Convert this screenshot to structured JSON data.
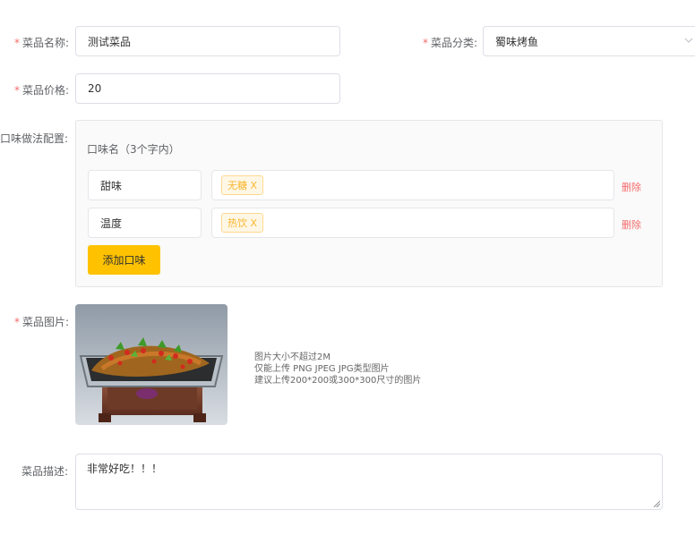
{
  "form": {
    "name": {
      "label": "菜品名称:",
      "value": "测试菜品"
    },
    "category": {
      "label": "菜品分类:",
      "value": "蜀味烤鱼"
    },
    "price": {
      "label": "菜品价格:",
      "value": "20"
    },
    "flavor": {
      "label": "口味做法配置:",
      "header": "口味名（3个字内）",
      "rows": [
        {
          "name": "甜味",
          "tag": "无糖 X",
          "delete": "删除"
        },
        {
          "name": "温度",
          "tag": "热饮 X",
          "delete": "删除"
        }
      ],
      "add_button": "添加口味"
    },
    "image": {
      "label": "菜品图片:",
      "tips": [
        "图片大小不超过2M",
        "仅能上传 PNG JPEG JPG类型图片",
        "建议上传200*200或300*300尺寸的图片"
      ]
    },
    "description": {
      "label": "菜品描述:",
      "value": "非常好吃！！！"
    }
  },
  "colors": {
    "required": "#f56c6c",
    "accent": "#ffc200",
    "tag_text": "#f9b62f"
  },
  "icons": [
    "chevron-down-icon",
    "resize-handle-icon"
  ]
}
